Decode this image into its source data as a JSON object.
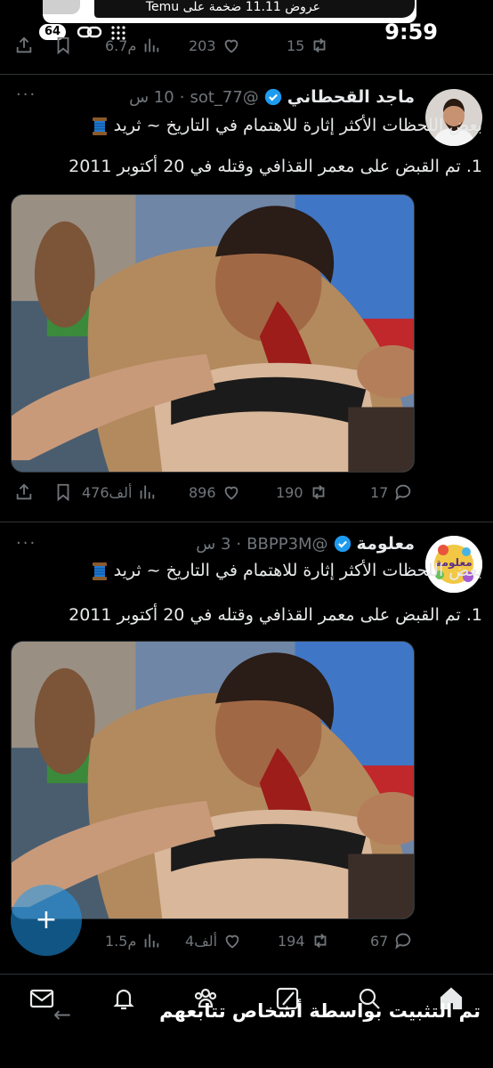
{
  "notification": {
    "text": "عروض 11.11 ضخمة على Temu"
  },
  "status_bar": {
    "badge": "64",
    "time": "9:59"
  },
  "top_actions": {
    "views": "6.7م",
    "likes": "203",
    "retweets": "15"
  },
  "tweets": [
    {
      "name": "ماجد القحطاني",
      "handle": "@sot_77",
      "time": "10 س",
      "separator": "·",
      "line1": "بعض اللحظات الأكثر إثارة للاهتمام في التاريخ ~ ثريد",
      "line2": "1. تم القبض على معمر القذافي وقتله في 20 أكتوبر 2011",
      "more": "···",
      "views": "476ألف",
      "likes": "896",
      "retweets": "190",
      "replies": "17"
    },
    {
      "name": "معلومة",
      "handle": "@BBPP3M",
      "time": "3 س",
      "separator": "·",
      "line1": "بعض اللحظات الأكثر إثارة للاهتمام في التاريخ ~ ثريد",
      "line2": "1. تم القبض على معمر القذافي وقتله في 20 أكتوبر 2011",
      "more": "···",
      "avatar_text": "معلومة",
      "views": "1.5م",
      "likes": "4ألف",
      "retweets": "194",
      "replies": "67"
    }
  ],
  "fab": {
    "label": "+"
  },
  "toast": {
    "text": "تم التثبيت بواسطة أشخاص تتابعهم"
  },
  "colors": {
    "background": "#000000",
    "accent": "#1d9bf0",
    "muted": "#71767b",
    "text": "#e7e9ea"
  }
}
